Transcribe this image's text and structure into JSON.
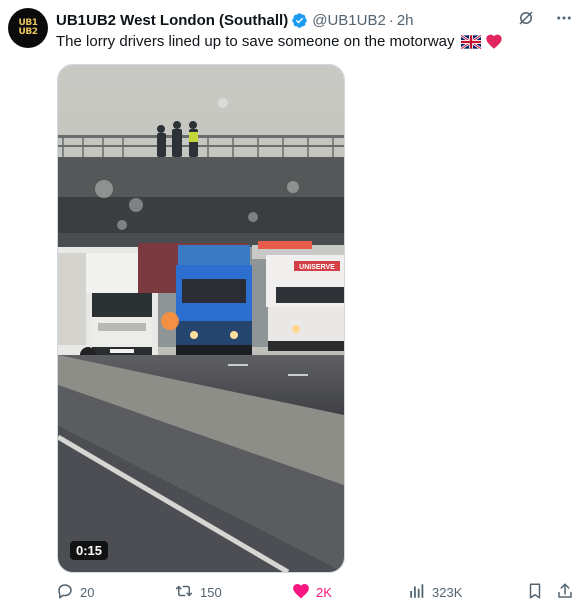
{
  "post": {
    "avatar_text_line1": "UB1",
    "avatar_text_line2": "UB2",
    "display_name": "UB1UB2 West London (Southall)",
    "handle": "@UB1UB2",
    "separator": "·",
    "time": "2h",
    "text": "The lorry drivers lined up to save someone on the motorway",
    "emojis": [
      "uk-flag",
      "red-heart"
    ]
  },
  "media": {
    "duration": "0:15",
    "truck_logos": [
      "UNISERVE"
    ]
  },
  "actions": {
    "replies": "20",
    "reposts": "150",
    "likes": "2K",
    "views": "323K"
  },
  "colors": {
    "like_pink": "#f91880",
    "verified_blue": "#1d9bf0",
    "muted": "#536471"
  }
}
